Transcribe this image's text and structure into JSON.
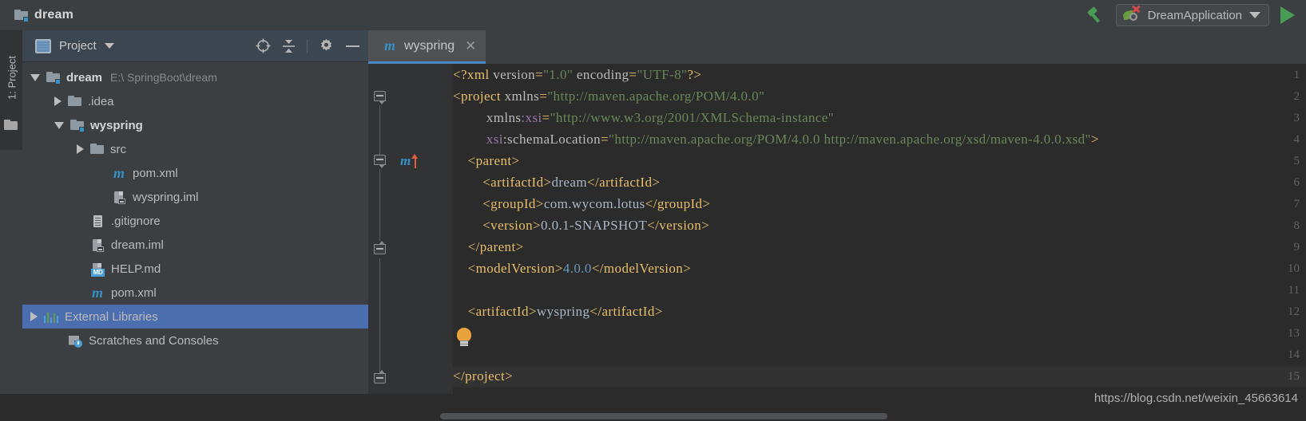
{
  "toolbar": {
    "project_name": "dream",
    "folder_icon": "folder-module-icon",
    "build_icon": "hammer-build-icon",
    "run_config": {
      "label": "DreamApplication",
      "icon": "spring-boot-config-icon",
      "dropdown_icon": "chevron-down-icon"
    },
    "run_icon": "run-play-icon"
  },
  "tool_window_strip": {
    "label": "1: Project",
    "folder_icon": "folder-icon"
  },
  "project_panel": {
    "header": {
      "title": "Project",
      "view_icon": "project-view-icon",
      "dropdown_icon": "chevron-down-icon",
      "locate_icon": "scroll-from-source-icon",
      "collapse_icon": "collapse-all-icon",
      "settings_icon": "gear-icon",
      "hide_icon": "minimize-icon"
    },
    "tree": [
      {
        "label": "dream",
        "path": "E:\\          SpringBoot\\dream",
        "icon": "folder-module-icon",
        "twisty": "open",
        "indent": 0,
        "bold": true,
        "selected": false
      },
      {
        "label": ".idea",
        "path": "",
        "icon": "folder-icon",
        "twisty": "closed",
        "indent": 1,
        "bold": false,
        "selected": false
      },
      {
        "label": "wyspring",
        "path": "",
        "icon": "folder-module-icon",
        "twisty": "open",
        "indent": 1,
        "bold": true,
        "selected": false
      },
      {
        "label": "src",
        "path": "",
        "icon": "folder-icon",
        "twisty": "closed",
        "indent": 2,
        "bold": false,
        "selected": false
      },
      {
        "label": "pom.xml",
        "path": "",
        "icon": "maven-icon",
        "twisty": "none",
        "indent": 3,
        "bold": false,
        "selected": false
      },
      {
        "label": "wyspring.iml",
        "path": "",
        "icon": "iml-icon",
        "twisty": "none",
        "indent": 3,
        "bold": false,
        "selected": false
      },
      {
        "label": ".gitignore",
        "path": "",
        "icon": "gitignore-icon",
        "twisty": "none",
        "indent": 2,
        "bold": false,
        "selected": false
      },
      {
        "label": "dream.iml",
        "path": "",
        "icon": "iml-icon",
        "twisty": "none",
        "indent": 2,
        "bold": false,
        "selected": false
      },
      {
        "label": "HELP.md",
        "path": "",
        "icon": "markdown-icon",
        "twisty": "none",
        "indent": 2,
        "bold": false,
        "selected": false
      },
      {
        "label": "pom.xml",
        "path": "",
        "icon": "maven-icon",
        "twisty": "none",
        "indent": 2,
        "bold": false,
        "selected": false
      },
      {
        "label": "External Libraries",
        "path": "",
        "icon": "libraries-icon",
        "twisty": "closed",
        "indent": 0,
        "bold": false,
        "selected": true
      },
      {
        "label": "Scratches and Consoles",
        "path": "",
        "icon": "scratches-icon",
        "twisty": "none",
        "indent": 1,
        "bold": false,
        "selected": false
      }
    ],
    "markdown_badge": "MD"
  },
  "editor": {
    "tabs": [
      {
        "label": "wyspring",
        "icon": "maven-icon",
        "close_icon": "close-icon",
        "active": true
      }
    ],
    "gutter": {
      "line_numbers": [
        "1",
        "2",
        "3",
        "4",
        "5",
        "6",
        "7",
        "8",
        "9",
        "10",
        "11",
        "12",
        "13",
        "14",
        "15"
      ],
      "maven_parent_icon": "maven-parent-nav-icon",
      "maven_parent_line": 5,
      "intention_bulb_icon": "intention-bulb-icon",
      "intention_bulb_line": 13
    },
    "lines": [
      {
        "n": 1,
        "tokens": [
          {
            "t": "tag",
            "v": "<?xml "
          },
          {
            "t": "attr",
            "v": "version"
          },
          {
            "t": "tag",
            "v": "="
          },
          {
            "t": "str",
            "v": "\"1.0\""
          },
          {
            "t": "attr",
            "v": " encoding"
          },
          {
            "t": "tag",
            "v": "="
          },
          {
            "t": "str",
            "v": "\"UTF-8\""
          },
          {
            "t": "tag",
            "v": "?>"
          }
        ]
      },
      {
        "n": 2,
        "tokens": [
          {
            "t": "tag",
            "v": "<project "
          },
          {
            "t": "attr",
            "v": "xmlns"
          },
          {
            "t": "tag",
            "v": "="
          },
          {
            "t": "str",
            "v": "\"http://maven.apache.org/POM/4.0.0\""
          }
        ]
      },
      {
        "n": 3,
        "tokens": [
          {
            "t": "attr",
            "v": "        xmlns"
          },
          {
            "t": "ns",
            "v": ":xsi"
          },
          {
            "t": "tag",
            "v": "="
          },
          {
            "t": "str",
            "v": "\"http://www.w3.org/2001/XMLSchema-instance\""
          }
        ]
      },
      {
        "n": 4,
        "tokens": [
          {
            "t": "ns",
            "v": "        xsi"
          },
          {
            "t": "attr",
            "v": ":schemaLocation"
          },
          {
            "t": "tag",
            "v": "="
          },
          {
            "t": "str",
            "v": "\"http://maven.apache.org/POM/4.0.0 http://maven.apache.org/xsd/maven-4.0.0.xsd\">"
          }
        ]
      },
      {
        "n": 5,
        "tokens": [
          {
            "t": "tag",
            "v": "    <parent>"
          }
        ]
      },
      {
        "n": 6,
        "tokens": [
          {
            "t": "tag",
            "v": "        <artifactId>"
          },
          {
            "t": "txt",
            "v": "dream"
          },
          {
            "t": "tag",
            "v": "</artifactId>"
          }
        ]
      },
      {
        "n": 7,
        "tokens": [
          {
            "t": "tag",
            "v": "        <groupId>"
          },
          {
            "t": "txt",
            "v": "com.wycom.lotus"
          },
          {
            "t": "tag",
            "v": "</groupId>"
          }
        ]
      },
      {
        "n": 8,
        "tokens": [
          {
            "t": "tag",
            "v": "        <version>"
          },
          {
            "t": "txt",
            "v": "0.0.1-SNAPSHOT"
          },
          {
            "t": "tag",
            "v": "</version>"
          }
        ]
      },
      {
        "n": 9,
        "tokens": [
          {
            "t": "tag",
            "v": "    </parent>"
          }
        ]
      },
      {
        "n": 10,
        "tokens": [
          {
            "t": "tag",
            "v": "    <modelVersion>"
          },
          {
            "t": "num",
            "v": "4.0.0"
          },
          {
            "t": "tag",
            "v": "</modelVersion>"
          }
        ]
      },
      {
        "n": 11,
        "tokens": [
          {
            "t": "tag",
            "v": ""
          }
        ]
      },
      {
        "n": 12,
        "tokens": [
          {
            "t": "tag",
            "v": "    <artifactId>"
          },
          {
            "t": "txt",
            "v": "wyspring"
          },
          {
            "t": "tag",
            "v": "</artifactId>"
          }
        ]
      },
      {
        "n": 13,
        "tokens": [
          {
            "t": "tag",
            "v": ""
          }
        ]
      },
      {
        "n": 14,
        "tokens": [
          {
            "t": "tag",
            "v": ""
          }
        ]
      },
      {
        "n": 15,
        "tokens": [
          {
            "t": "tag",
            "v": "</project>"
          }
        ]
      }
    ]
  },
  "watermark": "https://blog.csdn.net/weixin_45663614",
  "colors": {
    "bg_panel": "#3c3f41",
    "bg_editor": "#2b2b2b",
    "bg_gutter": "#313335",
    "selection": "#4b6eaf",
    "accent_tab": "#4a88c7",
    "maven_blue": "#3592c4",
    "tag": "#e8bf6a",
    "string": "#6a8759",
    "text": "#a9b7c6",
    "namespace": "#9876aa",
    "number": "#6897bb",
    "run_green": "#499c54"
  }
}
